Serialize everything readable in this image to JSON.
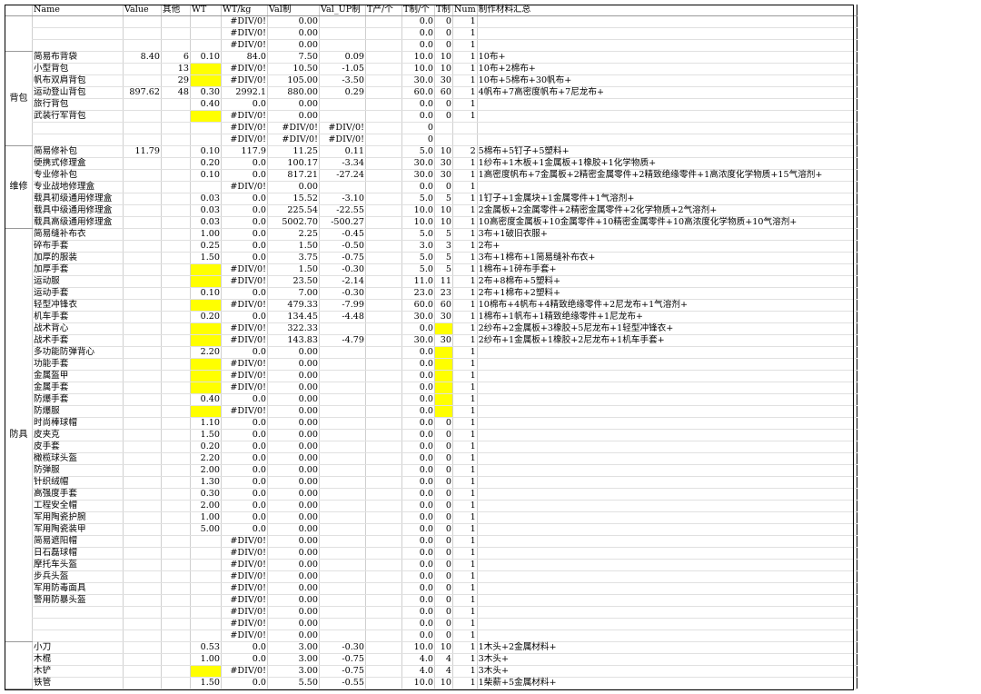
{
  "headers": [
    "",
    "Name",
    "Value",
    "其他",
    "WT",
    "WT/kg",
    "Val制",
    "Val_UP制",
    "T产/个",
    "T制/个",
    "T制",
    "Num",
    "制作材料汇总"
  ],
  "groups": [
    {
      "label": "",
      "rows": [
        [
          "",
          "",
          "",
          "",
          "#DIV/0!",
          "0.00",
          "",
          "",
          "0.0",
          "0",
          "1",
          ""
        ],
        [
          "",
          "",
          "",
          "",
          "#DIV/0!",
          "0.00",
          "",
          "",
          "0.0",
          "0",
          "1",
          ""
        ],
        [
          "",
          "",
          "",
          "",
          "#DIV/0!",
          "0.00",
          "",
          "",
          "0.0",
          "0",
          "1",
          ""
        ]
      ]
    },
    {
      "label": "背包",
      "rows": [
        [
          "简易布背袋",
          "8.40",
          "6",
          "0.10",
          "84.0",
          "7.50",
          "0.09",
          "",
          "10.0",
          "10",
          "1",
          "10布+"
        ],
        [
          "小型背包",
          "",
          "13",
          "",
          "#DIV/0!",
          "10.50",
          "-1.05",
          "",
          "10.0",
          "10",
          "1",
          "10布+2棉布+"
        ],
        [
          "帆布双肩背包",
          "",
          "29",
          "",
          "#DIV/0!",
          "105.00",
          "-3.50",
          "",
          "30.0",
          "30",
          "1",
          "10布+5棉布+30帆布+"
        ],
        [
          "运动登山背包",
          "897.62",
          "48",
          "0.30",
          "2992.1",
          "880.00",
          "0.29",
          "",
          "60.0",
          "60",
          "1",
          "4帆布+7高密度帆布+7尼龙布+"
        ],
        [
          "旅行背包",
          "",
          "",
          "0.40",
          "0.0",
          "0.00",
          "",
          "",
          "0.0",
          "0",
          "1",
          ""
        ],
        [
          "武装行军背包",
          "",
          "",
          "",
          "#DIV/0!",
          "0.00",
          "",
          "",
          "0.0",
          "0",
          "1",
          ""
        ],
        [
          "",
          "",
          "",
          "",
          "#DIV/0!",
          "#DIV/0!",
          "#DIV/0!",
          "",
          "0",
          "",
          "",
          ""
        ],
        [
          "",
          "",
          "",
          "",
          "#DIV/0!",
          "#DIV/0!",
          "#DIV/0!",
          "",
          "0",
          "",
          "",
          ""
        ]
      ]
    },
    {
      "label": "维修",
      "rows": [
        [
          "简易修补包",
          "11.79",
          "",
          "0.10",
          "117.9",
          "11.25",
          "0.11",
          "",
          "5.0",
          "10",
          "2",
          "5棉布+5钉子+5塑料+"
        ],
        [
          "便携式修理盒",
          "",
          "",
          "0.20",
          "0.0",
          "100.17",
          "-3.34",
          "",
          "30.0",
          "30",
          "1",
          "1纱布+1木板+1金属板+1橡胶+1化学物质+"
        ],
        [
          "专业修补包",
          "",
          "",
          "0.10",
          "0.0",
          "817.21",
          "-27.24",
          "",
          "30.0",
          "30",
          "1",
          "1高密度帆布+7金属板+2精密金属零件+2精致绝缘零件+1高浓度化学物质+15气溶剂+"
        ],
        [
          "专业战地修理盒",
          "",
          "",
          "",
          "#DIV/0!",
          "0.00",
          "",
          "",
          "0.0",
          "0",
          "1",
          ""
        ],
        [
          "载具初级通用修理盒",
          "",
          "",
          "0.03",
          "0.0",
          "15.52",
          "-3.10",
          "",
          "5.0",
          "5",
          "1",
          "1钉子+1金属块+1金属零件+1气溶剂+"
        ],
        [
          "载具中级通用修理盒",
          "",
          "",
          "0.03",
          "0.0",
          "225.54",
          "-22.55",
          "",
          "10.0",
          "10",
          "1",
          "2金属板+2金属零件+2精密金属零件+2化学物质+2气溶剂+"
        ],
        [
          "载具高级通用修理盒",
          "",
          "",
          "0.03",
          "0.0",
          "5002.70",
          "-500.27",
          "",
          "10.0",
          "10",
          "1",
          "10高密度金属板+10金属零件+10精密金属零件+10高浓度化学物质+10气溶剂+"
        ]
      ]
    },
    {
      "label": "防具",
      "rows": [
        [
          "简易缝补布衣",
          "",
          "",
          "1.00",
          "0.0",
          "2.25",
          "-0.45",
          "",
          "5.0",
          "5",
          "1",
          "3布+1破旧衣服+"
        ],
        [
          "碎布手套",
          "",
          "",
          "0.25",
          "0.0",
          "1.50",
          "-0.50",
          "",
          "3.0",
          "3",
          "1",
          "2布+"
        ],
        [
          "加厚的服装",
          "",
          "",
          "1.50",
          "0.0",
          "3.75",
          "-0.75",
          "",
          "5.0",
          "5",
          "1",
          "3布+1棉布+1简易缝补布衣+"
        ],
        [
          "加厚手套",
          "",
          "",
          "",
          "#DIV/0!",
          "1.50",
          "-0.30",
          "",
          "5.0",
          "5",
          "1",
          "1棉布+1碎布手套+"
        ],
        [
          "运动服",
          "",
          "",
          "",
          "#DIV/0!",
          "23.50",
          "-2.14",
          "",
          "11.0",
          "11",
          "1",
          "2布+8棉布+5塑料+"
        ],
        [
          "运动手套",
          "",
          "",
          "0.10",
          "0.0",
          "7.00",
          "-0.30",
          "",
          "23.0",
          "23",
          "1",
          "2布+1棉布+2塑料+"
        ],
        [
          "轻型冲锋衣",
          "",
          "",
          "",
          "#DIV/0!",
          "479.33",
          "-7.99",
          "",
          "60.0",
          "60",
          "1",
          "10棉布+4帆布+4精致绝缘零件+2尼龙布+1气溶剂+"
        ],
        [
          "机车手套",
          "",
          "",
          "0.20",
          "0.0",
          "134.45",
          "-4.48",
          "",
          "30.0",
          "30",
          "1",
          "1棉布+1帆布+1精致绝缘零件+1尼龙布+"
        ],
        [
          "战术背心",
          "",
          "",
          "",
          "#DIV/0!",
          "322.33",
          "",
          "",
          "0.0",
          "",
          "1",
          "2纱布+2金属板+3橡胶+5尼龙布+1轻型冲锋衣+"
        ],
        [
          "战术手套",
          "",
          "",
          "",
          "#DIV/0!",
          "143.83",
          "-4.79",
          "",
          "30.0",
          "30",
          "1",
          "2纱布+1金属板+1橡胶+2尼龙布+1机车手套+"
        ],
        [
          "多功能防弹背心",
          "",
          "",
          "2.20",
          "0.0",
          "0.00",
          "",
          "",
          "0.0",
          "",
          "1",
          ""
        ],
        [
          "功能手套",
          "",
          "",
          "",
          "#DIV/0!",
          "0.00",
          "",
          "",
          "0.0",
          "",
          "1",
          ""
        ],
        [
          "金属盔甲",
          "",
          "",
          "",
          "#DIV/0!",
          "0.00",
          "",
          "",
          "0.0",
          "",
          "1",
          ""
        ],
        [
          "金属手套",
          "",
          "",
          "",
          "#DIV/0!",
          "0.00",
          "",
          "",
          "0.0",
          "",
          "1",
          ""
        ],
        [
          "防爆手套",
          "",
          "",
          "0.40",
          "0.0",
          "0.00",
          "",
          "",
          "0.0",
          "",
          "1",
          ""
        ],
        [
          "防爆服",
          "",
          "",
          "",
          "#DIV/0!",
          "0.00",
          "",
          "",
          "0.0",
          "",
          "1",
          ""
        ],
        [
          "时尚棒球帽",
          "",
          "",
          "1.10",
          "0.0",
          "0.00",
          "",
          "",
          "0.0",
          "0",
          "1",
          ""
        ],
        [
          "皮夹克",
          "",
          "",
          "1.50",
          "0.0",
          "0.00",
          "",
          "",
          "0.0",
          "0",
          "1",
          ""
        ],
        [
          "皮手套",
          "",
          "",
          "0.20",
          "0.0",
          "0.00",
          "",
          "",
          "0.0",
          "0",
          "1",
          ""
        ],
        [
          "橄榄球头盔",
          "",
          "",
          "2.20",
          "0.0",
          "0.00",
          "",
          "",
          "0.0",
          "0",
          "1",
          ""
        ],
        [
          "防弹服",
          "",
          "",
          "2.00",
          "0.0",
          "0.00",
          "",
          "",
          "0.0",
          "0",
          "1",
          ""
        ],
        [
          "针织绒帽",
          "",
          "",
          "1.30",
          "0.0",
          "0.00",
          "",
          "",
          "0.0",
          "0",
          "1",
          ""
        ],
        [
          "高强度手套",
          "",
          "",
          "0.30",
          "0.0",
          "0.00",
          "",
          "",
          "0.0",
          "0",
          "1",
          ""
        ],
        [
          "工程安全帽",
          "",
          "",
          "2.00",
          "0.0",
          "0.00",
          "",
          "",
          "0.0",
          "0",
          "1",
          ""
        ],
        [
          "军用陶瓷护腕",
          "",
          "",
          "1.00",
          "0.0",
          "0.00",
          "",
          "",
          "0.0",
          "0",
          "1",
          ""
        ],
        [
          "军用陶瓷装甲",
          "",
          "",
          "5.00",
          "0.0",
          "0.00",
          "",
          "",
          "0.0",
          "0",
          "1",
          ""
        ],
        [
          "简易遮阳帽",
          "",
          "",
          "",
          "#DIV/0!",
          "0.00",
          "",
          "",
          "0.0",
          "0",
          "1",
          ""
        ],
        [
          "日石磊球帽",
          "",
          "",
          "",
          "#DIV/0!",
          "0.00",
          "",
          "",
          "0.0",
          "0",
          "1",
          ""
        ],
        [
          "摩托车头盔",
          "",
          "",
          "",
          "#DIV/0!",
          "0.00",
          "",
          "",
          "0.0",
          "0",
          "1",
          ""
        ],
        [
          "步兵头盔",
          "",
          "",
          "",
          "#DIV/0!",
          "0.00",
          "",
          "",
          "0.0",
          "0",
          "1",
          ""
        ],
        [
          "军用防毒面具",
          "",
          "",
          "",
          "#DIV/0!",
          "0.00",
          "",
          "",
          "0.0",
          "0",
          "1",
          ""
        ],
        [
          "警用防暴头盔",
          "",
          "",
          "",
          "#DIV/0!",
          "0.00",
          "",
          "",
          "0.0",
          "0",
          "1",
          ""
        ],
        [
          "",
          "",
          "",
          "",
          "#DIV/0!",
          "0.00",
          "",
          "",
          "0.0",
          "0",
          "1",
          ""
        ],
        [
          "",
          "",
          "",
          "",
          "#DIV/0!",
          "0.00",
          "",
          "",
          "0.0",
          "0",
          "1",
          ""
        ],
        [
          "",
          "",
          "",
          "",
          "#DIV/0!",
          "0.00",
          "",
          "",
          "0.0",
          "0",
          "1",
          ""
        ]
      ]
    },
    {
      "label": "",
      "rows": [
        [
          "小刀",
          "",
          "",
          "0.53",
          "0.0",
          "3.00",
          "-0.30",
          "",
          "10.0",
          "10",
          "1",
          "1木头+2金属材料+"
        ],
        [
          "木棍",
          "",
          "",
          "1.00",
          "0.0",
          "3.00",
          "-0.75",
          "",
          "4.0",
          "4",
          "1",
          "3木头+"
        ],
        [
          "木铲",
          "",
          "",
          "",
          "#DIV/0!",
          "3.00",
          "-0.75",
          "",
          "4.0",
          "4",
          "1",
          "3木头+"
        ],
        [
          "铁管",
          "",
          "",
          "1.50",
          "0.0",
          "5.50",
          "-0.55",
          "",
          "10.0",
          "10",
          "1",
          "1柴薪+5金属材料+"
        ]
      ]
    }
  ],
  "highlight_color": "#ffff00"
}
